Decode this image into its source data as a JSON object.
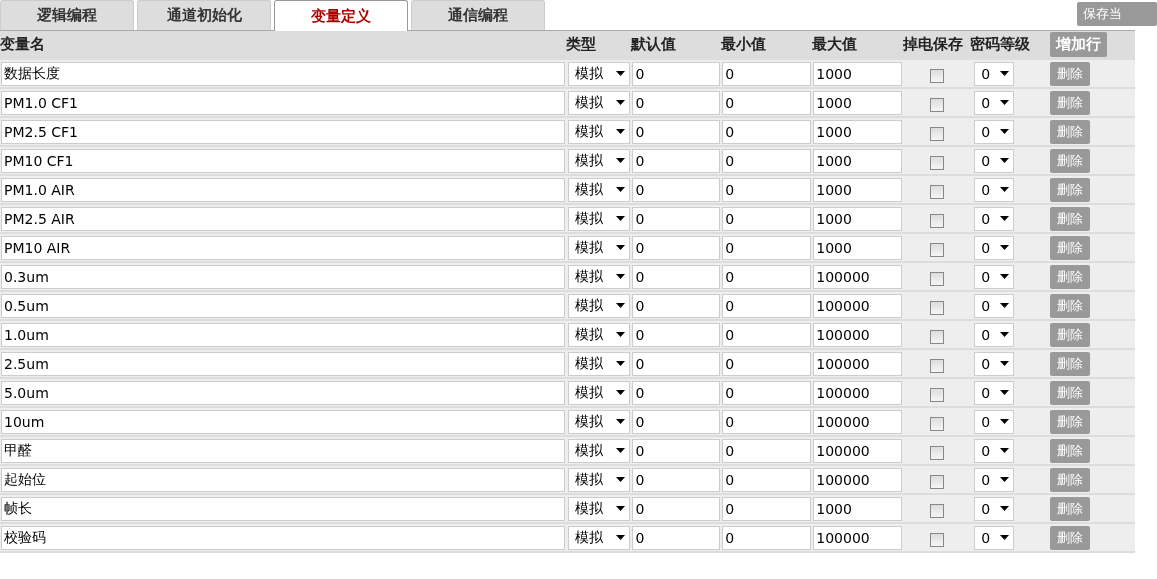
{
  "tabs": [
    {
      "label": "逻辑编程",
      "selected": false
    },
    {
      "label": "通道初始化",
      "selected": false
    },
    {
      "label": "变量定义",
      "selected": true
    },
    {
      "label": "通信编程",
      "selected": false
    }
  ],
  "save_button": "保存当",
  "table": {
    "columns": [
      "变量名",
      "类型",
      "默认值",
      "最小值",
      "最大值",
      "掉电保存",
      "密码等级"
    ],
    "add_row_button": "增加行",
    "rows": [
      {
        "name": "数据长度",
        "type": "模拟",
        "default": "0",
        "min": "0",
        "max": "1000",
        "power_save": false,
        "level": "0",
        "delete": "删除"
      },
      {
        "name": "PM1.0 CF1",
        "type": "模拟",
        "default": "0",
        "min": "0",
        "max": "1000",
        "power_save": false,
        "level": "0",
        "delete": "删除"
      },
      {
        "name": "PM2.5 CF1",
        "type": "模拟",
        "default": "0",
        "min": "0",
        "max": "1000",
        "power_save": false,
        "level": "0",
        "delete": "删除"
      },
      {
        "name": "PM10 CF1",
        "type": "模拟",
        "default": "0",
        "min": "0",
        "max": "1000",
        "power_save": false,
        "level": "0",
        "delete": "删除"
      },
      {
        "name": "PM1.0 AIR",
        "type": "模拟",
        "default": "0",
        "min": "0",
        "max": "1000",
        "power_save": false,
        "level": "0",
        "delete": "删除"
      },
      {
        "name": "PM2.5 AIR",
        "type": "模拟",
        "default": "0",
        "min": "0",
        "max": "1000",
        "power_save": false,
        "level": "0",
        "delete": "删除"
      },
      {
        "name": "PM10 AIR",
        "type": "模拟",
        "default": "0",
        "min": "0",
        "max": "1000",
        "power_save": false,
        "level": "0",
        "delete": "删除"
      },
      {
        "name": "0.3um",
        "type": "模拟",
        "default": "0",
        "min": "0",
        "max": "100000",
        "power_save": false,
        "level": "0",
        "delete": "删除"
      },
      {
        "name": "0.5um",
        "type": "模拟",
        "default": "0",
        "min": "0",
        "max": "100000",
        "power_save": false,
        "level": "0",
        "delete": "删除"
      },
      {
        "name": "1.0um",
        "type": "模拟",
        "default": "0",
        "min": "0",
        "max": "100000",
        "power_save": false,
        "level": "0",
        "delete": "删除"
      },
      {
        "name": "2.5um",
        "type": "模拟",
        "default": "0",
        "min": "0",
        "max": "100000",
        "power_save": false,
        "level": "0",
        "delete": "删除"
      },
      {
        "name": "5.0um",
        "type": "模拟",
        "default": "0",
        "min": "0",
        "max": "100000",
        "power_save": false,
        "level": "0",
        "delete": "删除"
      },
      {
        "name": "10um",
        "type": "模拟",
        "default": "0",
        "min": "0",
        "max": "100000",
        "power_save": false,
        "level": "0",
        "delete": "删除"
      },
      {
        "name": "甲醛",
        "type": "模拟",
        "default": "0",
        "min": "0",
        "max": "100000",
        "power_save": false,
        "level": "0",
        "delete": "删除"
      },
      {
        "name": "起始位",
        "type": "模拟",
        "default": "0",
        "min": "0",
        "max": "100000",
        "power_save": false,
        "level": "0",
        "delete": "删除"
      },
      {
        "name": "帧长",
        "type": "模拟",
        "default": "0",
        "min": "0",
        "max": "1000",
        "power_save": false,
        "level": "0",
        "delete": "删除"
      },
      {
        "name": "校验码",
        "type": "模拟",
        "default": "0",
        "min": "0",
        "max": "100000",
        "power_save": false,
        "level": "0",
        "delete": "删除"
      }
    ]
  }
}
